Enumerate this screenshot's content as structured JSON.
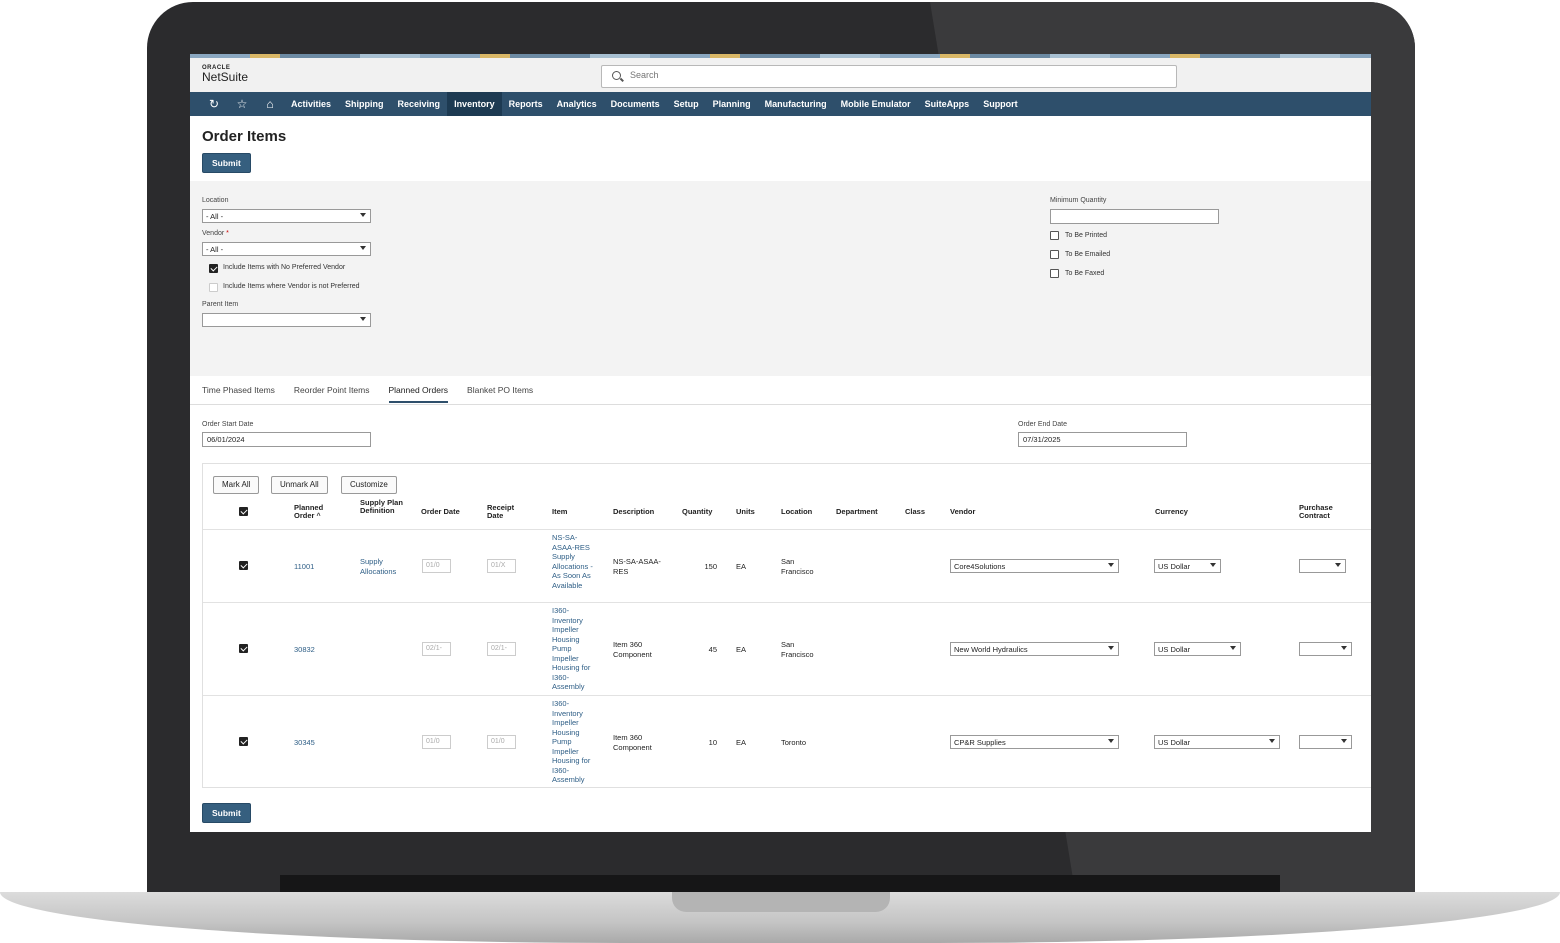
{
  "app": {
    "brand_top": "ORACLE",
    "brand": "NetSuite"
  },
  "search": {
    "placeholder": "Search"
  },
  "nav": {
    "icons": [
      "recent-icon",
      "star-icon",
      "home-icon"
    ],
    "items": [
      "Activities",
      "Shipping",
      "Receiving",
      "Inventory",
      "Reports",
      "Analytics",
      "Documents",
      "Setup",
      "Planning",
      "Manufacturing",
      "Mobile Emulator",
      "SuiteApps",
      "Support"
    ],
    "active": "Inventory"
  },
  "page": {
    "title": "Order Items",
    "submit_label": "Submit"
  },
  "filters": {
    "location_label": "Location",
    "location_value": "- All -",
    "vendor_label": "Vendor",
    "vendor_required": "*",
    "vendor_value": "- All -",
    "chk_no_preferred": "Include Items with No Preferred Vendor",
    "chk_not_preferred": "Include Items where Vendor is not Preferred",
    "parent_item_label": "Parent Item",
    "parent_item_value": "",
    "min_qty_label": "Minimum Quantity",
    "min_qty_value": "",
    "to_be_printed": "To Be Printed",
    "to_be_emailed": "To Be Emailed",
    "to_be_faxed": "To Be Faxed"
  },
  "tabs": [
    "Time Phased Items",
    "Reorder Point Items",
    "Planned Orders",
    "Blanket PO Items"
  ],
  "dates": {
    "start_label": "Order Start Date",
    "start_value": "06/01/2024",
    "end_label": "Order End Date",
    "end_value": "07/31/2025"
  },
  "grid": {
    "buttons": {
      "mark_all": "Mark All",
      "unmark_all": "Unmark All",
      "customize": "Customize"
    },
    "headers": {
      "planned_order": "Planned Order",
      "supply_plan": "Supply Plan Definition",
      "order_date": "Order Date",
      "receipt_date": "Receipt Date",
      "item": "Item",
      "description": "Description",
      "quantity": "Quantity",
      "units": "Units",
      "location": "Location",
      "department": "Department",
      "class": "Class",
      "vendor": "Vendor",
      "currency": "Currency",
      "purchase_contract": "Purchase Contract"
    },
    "rows": [
      {
        "order": "11001",
        "supply_plan": "Supply Allocations",
        "order_date": "01/0",
        "receipt_date": "01/X",
        "item": "NS-SA-ASAA-RES Supply Allocations - As Soon As Available",
        "description": "NS-SA-ASAA-RES",
        "quantity": "150",
        "units": "EA",
        "location": "San Francisco",
        "vendor": "Core4Solutions",
        "currency": "US Dollar"
      },
      {
        "order": "30832",
        "supply_plan": "",
        "order_date": "02/1-",
        "receipt_date": "02/1-",
        "item": "I360-Inventory Impeller Housing Pump Impeller Housing for I360-Assembly",
        "description": "Item 360 Component",
        "quantity": "45",
        "units": "EA",
        "location": "San Francisco",
        "vendor": "New World Hydraulics",
        "currency": "US Dollar"
      },
      {
        "order": "30345",
        "supply_plan": "",
        "order_date": "01/0",
        "receipt_date": "01/0",
        "item": "I360-Inventory Impeller Housing Pump Impeller Housing for I360-Assembly",
        "description": "Item 360 Component",
        "quantity": "10",
        "units": "EA",
        "location": "Toronto",
        "vendor": "CP&R Supplies",
        "currency": "US Dollar"
      }
    ]
  }
}
